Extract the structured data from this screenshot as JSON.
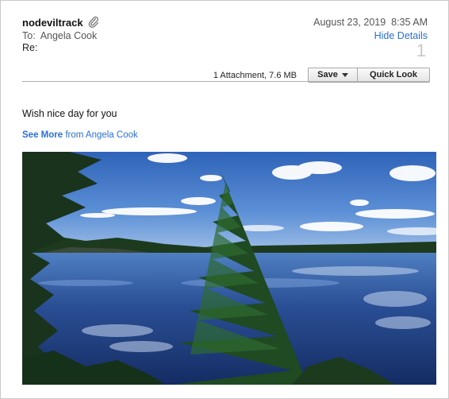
{
  "header": {
    "sender": "nodeviltrack",
    "to_label": "To:",
    "to_name": "Angela Cook",
    "re_label": "Re:",
    "date": "August 23, 2019",
    "time": "8:35 AM",
    "hide_details": "Hide Details",
    "message_count": "1"
  },
  "attachments": {
    "info": "1 Attachment, 7.6 MB",
    "save_label": "Save",
    "quick_look_label": "Quick Look"
  },
  "body": {
    "text": "Wish nice day for you",
    "see_more_bold": "See More",
    "see_more_rest": " from Angela Cook"
  },
  "colors": {
    "link": "#2a6fd6",
    "sky": "#3f74c4",
    "water": "#1f3f80"
  },
  "icons": [
    "paperclip-icon",
    "dropdown-caret-icon"
  ]
}
